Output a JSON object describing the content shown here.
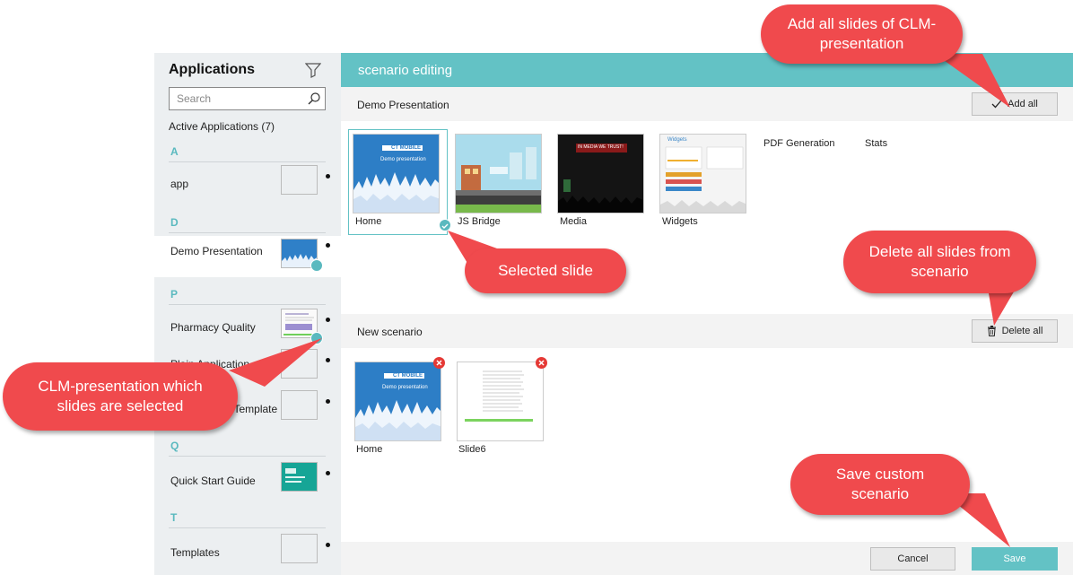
{
  "sidebar": {
    "title": "Applications",
    "search_placeholder": "Search",
    "active_label": "Active Applications (7)",
    "letters": [
      "A",
      "D",
      "P",
      "Q",
      "T"
    ],
    "apps": [
      {
        "name": "app"
      },
      {
        "name": "Demo Presentation"
      },
      {
        "name": "Pharmacy Quality"
      },
      {
        "name": "Plain Application"
      },
      {
        "name": "Presentation Template"
      },
      {
        "name": "Quick Start Guide"
      },
      {
        "name": "Templates"
      }
    ]
  },
  "main": {
    "title": "scenario editing",
    "presentation_section": {
      "title": "Demo Presentation",
      "add_all_label": "Add all",
      "slides": [
        {
          "label": "Home"
        },
        {
          "label": "JS Bridge"
        },
        {
          "label": "Media"
        },
        {
          "label": "Widgets"
        },
        {
          "label": "PDF Generation"
        },
        {
          "label": "Stats"
        }
      ]
    },
    "scenario_section": {
      "title": "New scenario",
      "delete_all_label": "Delete all",
      "slides": [
        {
          "label": "Home"
        },
        {
          "label": "Slide6"
        }
      ]
    },
    "footer": {
      "cancel_label": "Cancel",
      "save_label": "Save"
    }
  },
  "thumb_text": {
    "logo": "CT MOBILE",
    "subtitle": "Demo presentation",
    "media_banner": "IN MEDIA WE TRUST!",
    "widgets_title": "Widgets"
  },
  "callouts": {
    "add_all": "Add all slides of CLM-presentation",
    "selected_slide": "Selected slide",
    "delete_all": "Delete all slides from scenario",
    "clm_presentation": "CLM-presentation which slides are selected",
    "save": "Save custom scenario"
  },
  "colors": {
    "accent": "#63c2c5",
    "callout": "#f04a4d",
    "remove": "#e53935"
  }
}
